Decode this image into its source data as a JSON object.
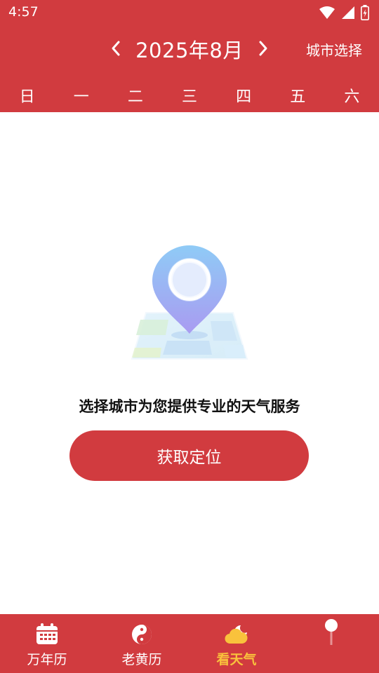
{
  "status_bar": {
    "time": "4:57",
    "icons": [
      "wifi-icon",
      "signal-icon",
      "battery-icon"
    ]
  },
  "header": {
    "month_title": "2025年8月",
    "city_select": "城市选择",
    "prev_icon": "chevron-left-icon",
    "next_icon": "chevron-right-icon",
    "weekdays": [
      "日",
      "一",
      "二",
      "三",
      "四",
      "五",
      "六"
    ]
  },
  "main": {
    "illustration_icon": "location-pin-map-icon",
    "prompt": "选择城市为您提供专业的天气服务",
    "locate_button": "获取定位"
  },
  "bottom_nav": {
    "items": [
      {
        "label": "万年历",
        "icon": "calendar-icon",
        "active": false
      },
      {
        "label": "老黄历",
        "icon": "yin-yang-icon",
        "active": false
      },
      {
        "label": "看天气",
        "icon": "weather-icon",
        "active": true
      },
      {
        "label": "",
        "icon": "lightbulb-icon",
        "active": false
      }
    ]
  },
  "colors": {
    "primary": "#D13B3F",
    "active_tab": "#F9C23C",
    "text": "#111111",
    "background": "#FFFFFF"
  }
}
